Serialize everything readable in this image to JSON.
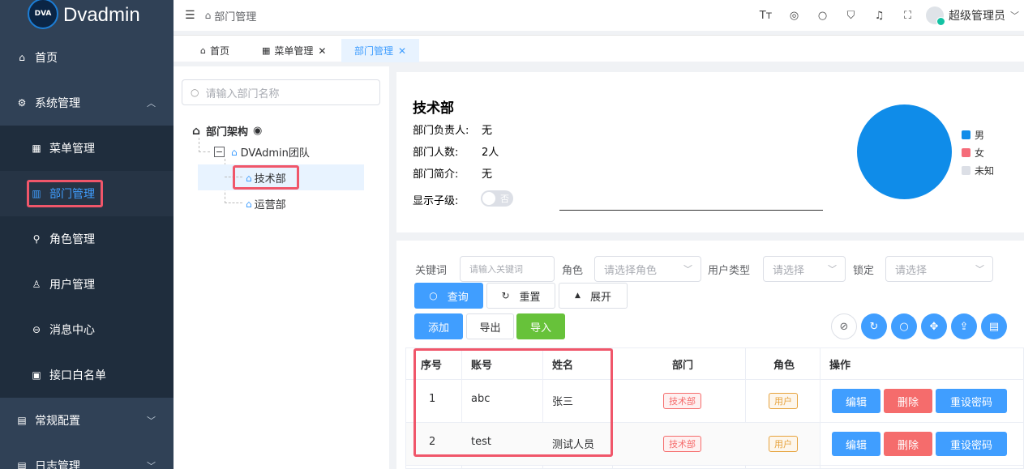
{
  "app": {
    "logo_badge": "DVA",
    "name": "Dvadmin"
  },
  "sidebar": {
    "items": [
      {
        "label": "首页",
        "icon": "home-icon"
      },
      {
        "label": "系统管理",
        "icon": "gear-icon",
        "expanded": true
      },
      {
        "label": "菜单管理",
        "icon": "grid-icon"
      },
      {
        "label": "部门管理",
        "icon": "building-icon",
        "active": true
      },
      {
        "label": "角色管理",
        "icon": "role-icon"
      },
      {
        "label": "用户管理",
        "icon": "user-icon"
      },
      {
        "label": "消息中心",
        "icon": "message-icon"
      },
      {
        "label": "接口白名单",
        "icon": "whitelist-icon"
      },
      {
        "label": "常规配置",
        "icon": "config-icon"
      },
      {
        "label": "日志管理",
        "icon": "log-icon"
      }
    ]
  },
  "header": {
    "breadcrumb": "部门管理",
    "user_name": "超级管理员",
    "icons": [
      "font-size-icon",
      "language-icon",
      "search-icon",
      "theme-icon",
      "bell-icon",
      "fullscreen-icon"
    ]
  },
  "tabs": [
    {
      "label": "首页",
      "closable": false
    },
    {
      "label": "菜单管理",
      "closable": true
    },
    {
      "label": "部门管理",
      "closable": true,
      "active": true
    }
  ],
  "tree": {
    "search_placeholder": "请输入部门名称",
    "root": "部门架构",
    "team": "DVAdmin团队",
    "children": [
      "技术部",
      "运营部"
    ]
  },
  "dept_info": {
    "name": "技术部",
    "rows": [
      {
        "label": "部门负责人:",
        "value": "无"
      },
      {
        "label": "部门人数:",
        "value": "2人"
      },
      {
        "label": "部门简介:",
        "value": "无"
      }
    ],
    "show_children_label": "显示子级:",
    "show_children_value": "否",
    "pie": {
      "legend": [
        "男",
        "女",
        "未知"
      ],
      "colors": [
        "#0f8ce9",
        "#f56c7a",
        "#dcdfe6"
      ]
    }
  },
  "filters": {
    "keyword_label": "关键词",
    "keyword_placeholder": "请输入关键词",
    "role_label": "角色",
    "role_placeholder": "请选择角色",
    "usertype_label": "用户类型",
    "usertype_placeholder": "请选择",
    "lock_label": "锁定",
    "lock_placeholder": "请选择",
    "query": "查询",
    "reset": "重置",
    "expand": "展开"
  },
  "actions": {
    "add": "添加",
    "export": "导出",
    "import": "导入"
  },
  "table": {
    "columns": [
      "序号",
      "账号",
      "姓名",
      "部门",
      "角色",
      "操作"
    ],
    "rows": [
      {
        "index": "1",
        "account": "abc",
        "name": "张三",
        "dept": "技术部",
        "role": "用户"
      },
      {
        "index": "2",
        "account": "test",
        "name": "测试人员",
        "dept": "技术部",
        "role": "用户"
      }
    ],
    "row_actions": [
      "编辑",
      "删除",
      "重设密码"
    ]
  }
}
